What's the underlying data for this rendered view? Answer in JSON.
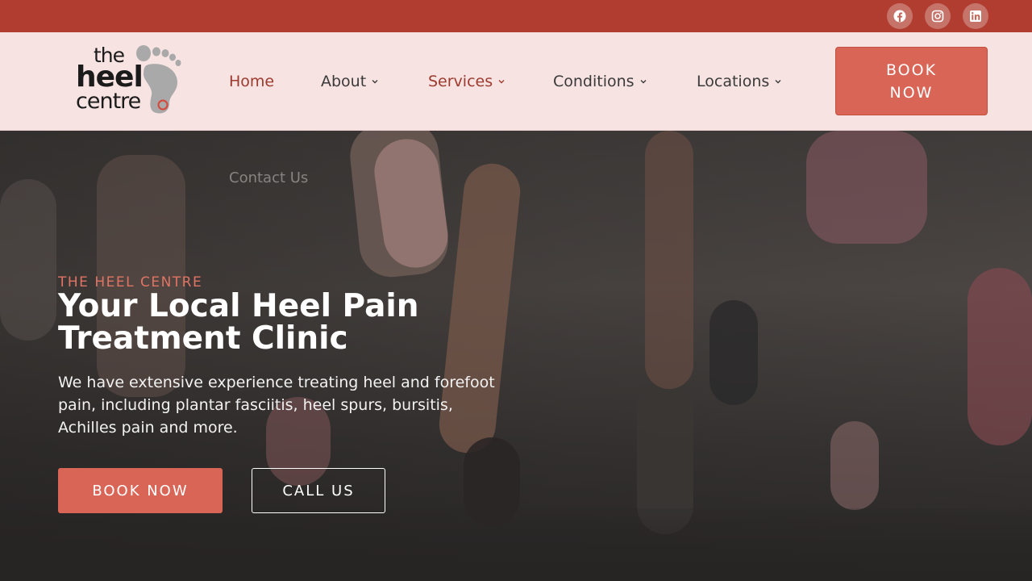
{
  "colors": {
    "topbar": "#b13d31",
    "header_bg": "#f8e3e3",
    "accent": "#d96556",
    "active_nav": "#9c3a2e"
  },
  "social": [
    {
      "icon": "facebook-icon"
    },
    {
      "icon": "instagram-icon"
    },
    {
      "icon": "linkedin-icon"
    }
  ],
  "logo": {
    "line1": "the",
    "line2": "heel",
    "line3": "centre"
  },
  "nav": {
    "items": [
      {
        "label": "Home",
        "active": true
      },
      {
        "label": "About",
        "dropdown": true
      },
      {
        "label": "Services",
        "dropdown": true
      },
      {
        "label": "Conditions",
        "dropdown": true
      },
      {
        "label": "Locations",
        "dropdown": true
      }
    ],
    "book_line1": "BOOK",
    "book_line2": "NOW",
    "submenu_hint": "Contact Us"
  },
  "hero": {
    "eyebrow": "THE HEEL CENTRE",
    "headline_line1": "Your Local Heel Pain",
    "headline_line2": "Treatment Clinic",
    "description": "We have extensive experience treating heel and forefoot pain, including plantar fasciitis, heel spurs, bursitis, Achilles pain and more.",
    "book_button": "BOOK NOW",
    "call_button": "CALL US"
  }
}
